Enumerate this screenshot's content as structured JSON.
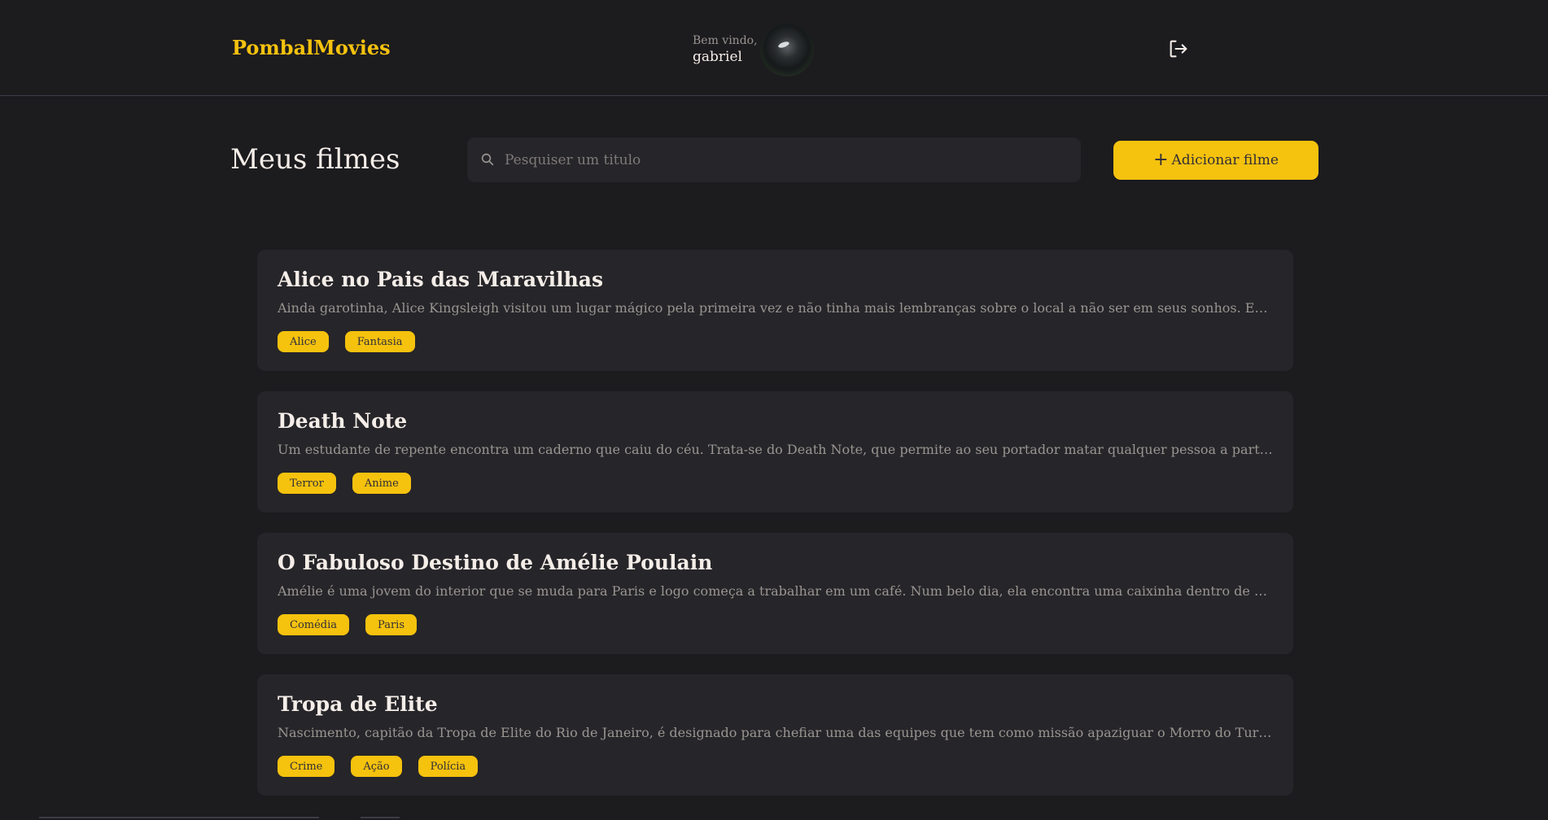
{
  "header": {
    "brand": "PombalMovies",
    "welcome": "Bem vindo,",
    "username": "gabriel"
  },
  "main": {
    "title": "Meus filmes",
    "search_placeholder": "Pesquiser um titulo",
    "add_button": "Adicionar filme"
  },
  "movies": [
    {
      "title": "Alice no Pais das Maravilhas",
      "description": "Ainda garotinha, Alice Kingsleigh visitou um lugar mágico pela primeira vez e não tinha mais lembranças sobre o local a não ser em seus sonhos. Em uma fe...",
      "tags": [
        "Alice",
        "Fantasia"
      ]
    },
    {
      "title": "Death Note",
      "description": "Um estudante de repente encontra um caderno que caiu do céu. Trata-se do Death Note, que permite ao seu portador matar qualquer pessoa a partir da mera a...",
      "tags": [
        "Terror",
        "Anime"
      ]
    },
    {
      "title": "O Fabuloso Destino de Amélie Poulain",
      "description": "Amélie é uma jovem do interior que se muda para Paris e logo começa a trabalhar em um café. Num belo dia, ela encontra uma caixinha dentro de seu aparta...",
      "tags": [
        "Comédia",
        "Paris"
      ]
    },
    {
      "title": "Tropa de Elite",
      "description": "Nascimento, capitão da Tropa de Elite do Rio de Janeiro, é designado para chefiar uma das equipes que tem como missão apaziguar o Morro do Turano. Ele pre...",
      "tags": [
        "Crime",
        "Ação",
        "Polícia"
      ]
    }
  ],
  "colors": {
    "background": "#1c1b1e",
    "card": "#262529",
    "accent": "#f5c20e",
    "text": "#f4ede8",
    "muted": "#999591"
  },
  "icons": {
    "logout": "logout-icon",
    "search": "search-icon",
    "add": "plus-icon"
  }
}
